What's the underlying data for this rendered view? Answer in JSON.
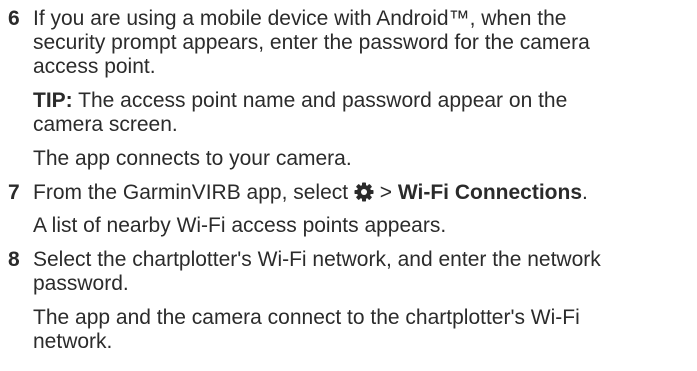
{
  "steps": [
    {
      "number": "6",
      "lines": [
        "If you are using a mobile device with Android™, when the",
        "security prompt appears, enter the password for the camera",
        "access point."
      ],
      "tip_label": "TIP:",
      "tip_lines": [
        " The access point name and password appear on the",
        "camera screen."
      ],
      "result": "The app connects to your camera."
    },
    {
      "number": "7",
      "text_before_icon": "From the GarminVIRB app, select ",
      "icon": "gear-icon",
      "text_after_icon": " > ",
      "bold_target": "Wi-Fi Connections",
      "text_end": ".",
      "result": "A list of nearby Wi-Fi access points appears."
    },
    {
      "number": "8",
      "lines": [
        "Select the chartplotter's Wi-Fi network, and enter the network",
        "password."
      ],
      "result_lines": [
        "The app and the camera connect to the chartplotter's Wi-Fi",
        "network."
      ]
    }
  ]
}
